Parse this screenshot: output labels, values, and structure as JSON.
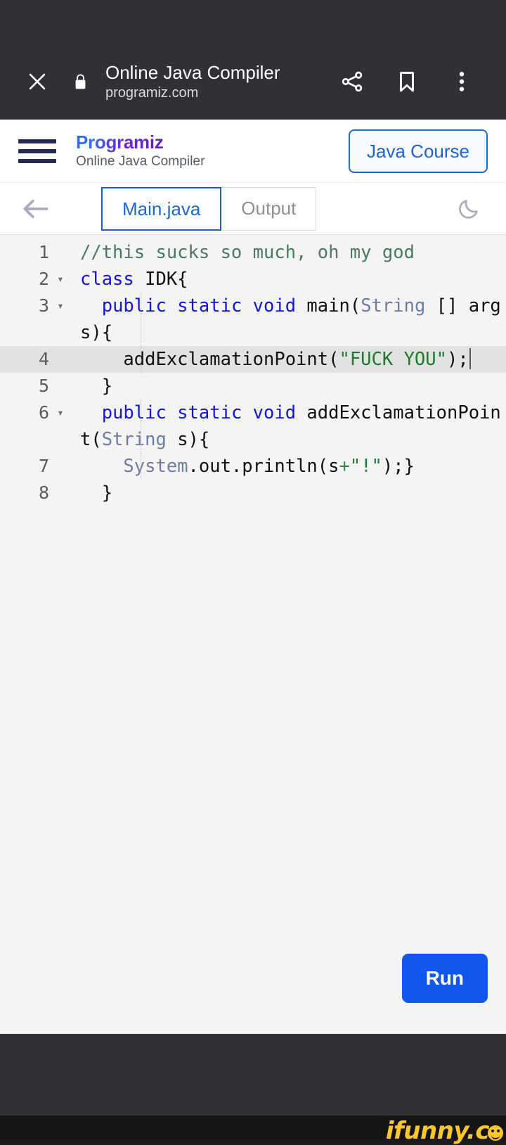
{
  "browser": {
    "close_icon": "close-icon",
    "lock_icon": "lock-icon",
    "page_title": "Online Java Compiler",
    "page_url": "programiz.com",
    "share_icon": "share-icon",
    "bookmark_icon": "bookmark-icon",
    "overflow_icon": "more-vertical-icon"
  },
  "site_header": {
    "menu_icon": "hamburger-menu-icon",
    "logo_text": "Programiz",
    "tagline": "Online Java Compiler",
    "course_button": "Java Course",
    "accent_color": "#2f6df6",
    "logo_gradient_end": "#5b21b6"
  },
  "editor_header": {
    "back_icon": "arrow-left-icon",
    "theme_icon": "moon-icon",
    "tabs": [
      {
        "label": "Main.java",
        "active": true
      },
      {
        "label": "Output",
        "active": false
      }
    ],
    "active_tab_color": "#1a66d0",
    "inactive_tab_color": "#8f8f98"
  },
  "editor": {
    "language": "java",
    "active_line": 4,
    "caret_line": 4,
    "background": "#f4f4f4",
    "active_line_background": "#e2e2e2",
    "lines": [
      {
        "number": "1",
        "foldable": false,
        "text": "//this sucks so much, oh my god"
      },
      {
        "number": "2",
        "foldable": true,
        "text": "class IDK{"
      },
      {
        "number": "3",
        "foldable": true,
        "text": "    public static void main(String [] args){"
      },
      {
        "number": "4",
        "foldable": false,
        "text": "        addExclamationPoint(\"FUCK YOU\");"
      },
      {
        "number": "5",
        "foldable": false,
        "text": "    }"
      },
      {
        "number": "6",
        "foldable": true,
        "text": "    public static void addExclamationPoint(String s){"
      },
      {
        "number": "7",
        "foldable": false,
        "text": "        System.out.println(s+\"!\");}"
      },
      {
        "number": "8",
        "foldable": false,
        "text": "    }"
      }
    ],
    "syntax_colors": {
      "keyword": "#1414dd",
      "type": "#6e7da1",
      "comment": "#4a7a60",
      "string": "#1e7a2e",
      "operator": "#2b8a4a",
      "plain": "#111111"
    }
  },
  "run": {
    "label": "Run",
    "color": "#1255ef"
  },
  "watermark": {
    "text": "ifunny.c",
    "color": "#fcc72c"
  }
}
